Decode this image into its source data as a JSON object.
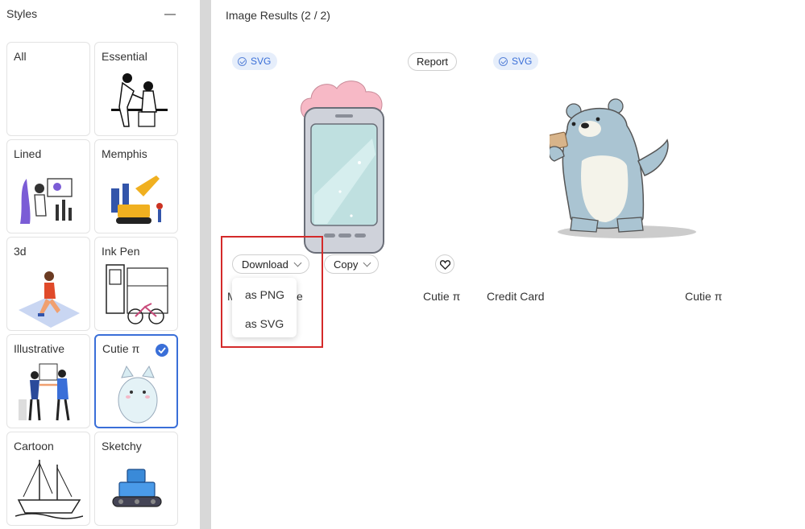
{
  "sidebar": {
    "title": "Styles",
    "collapse_icon": "minus-icon",
    "styles": [
      {
        "label": "All",
        "thumb": ""
      },
      {
        "label": "Essential",
        "thumb": "essential-illustration"
      },
      {
        "label": "Lined",
        "thumb": "lined-illustration"
      },
      {
        "label": "Memphis",
        "thumb": "memphis-illustration"
      },
      {
        "label": "3d",
        "thumb": "3d-illustration"
      },
      {
        "label": "Ink Pen",
        "thumb": "ink-pen-illustration"
      },
      {
        "label": "Illustrative",
        "thumb": "illustrative-illustration"
      },
      {
        "label": "Cutie π",
        "thumb": "cutie-pi-illustration",
        "selected": true
      },
      {
        "label": "Cartoon",
        "thumb": "cartoon-illustration"
      },
      {
        "label": "Sketchy",
        "thumb": "sketchy-illustration"
      }
    ]
  },
  "main": {
    "title": "Image Results (2 / 2)",
    "results": [
      {
        "badge": "SVG",
        "report_label": "Report",
        "download_label": "Download",
        "copy_label": "Copy",
        "name": "M",
        "name_tail": "e",
        "style": "Cutie π",
        "image": "phone-with-cloud"
      },
      {
        "badge": "SVG",
        "name": "Credit Card",
        "style": "Cutie π",
        "image": "polar-bear-holding-card"
      }
    ],
    "download_menu": {
      "items": [
        "as PNG",
        "as SVG"
      ]
    }
  },
  "colors": {
    "accent": "#3a6fd8",
    "highlight_box": "#d42a2a",
    "badge_bg": "#e6eefb"
  }
}
